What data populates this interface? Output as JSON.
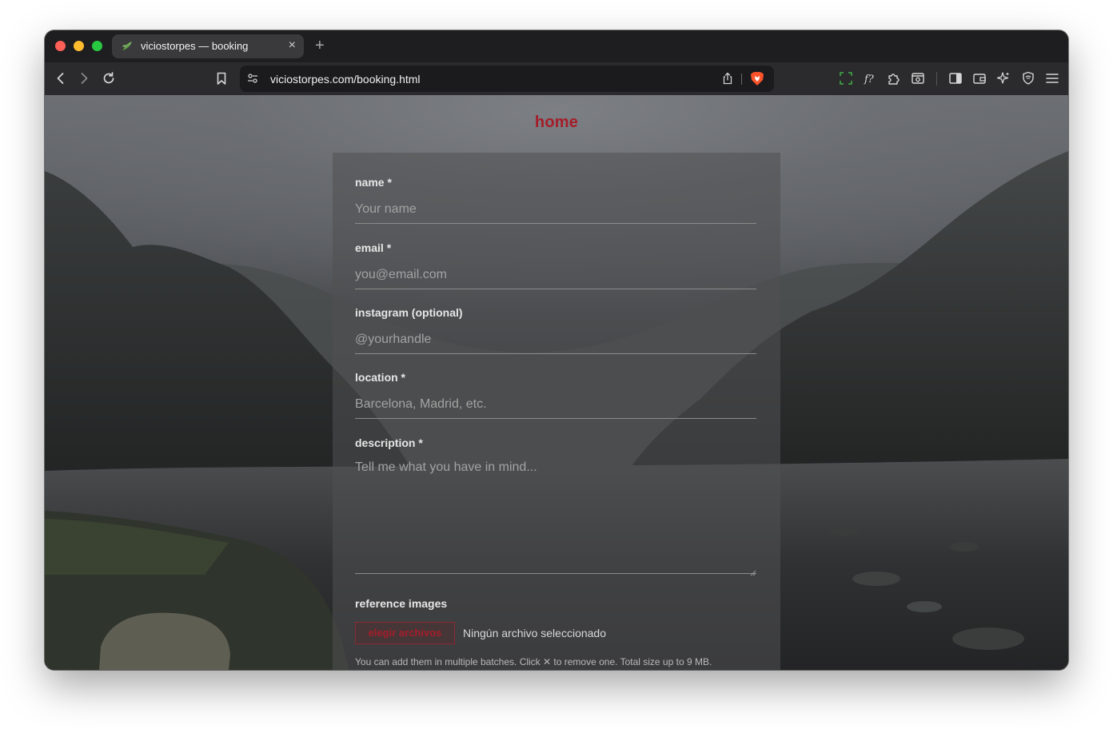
{
  "browser": {
    "tab": {
      "title": "viciostorpes — booking",
      "close_glyph": "×"
    },
    "new_tab_glyph": "+",
    "address_bar": {
      "url": "viciostorpes.com/booking.html"
    },
    "icons": {
      "back": "chevron-left-icon",
      "forward": "chevron-right-icon",
      "reload": "reload-icon",
      "bookmark": "bookmark-icon",
      "site_settings": "tune-icon",
      "share": "share-icon",
      "brave_shields": "brave-lion-icon",
      "screenshot": "screenshot-icon",
      "font": "font-icon",
      "extensions": "puzzle-icon",
      "reader": "reader-icon",
      "sidebar": "sidebar-icon",
      "wallet": "wallet-icon",
      "leo": "sparkle-icon",
      "vpn": "shield-icon",
      "menu": "hamburger-icon"
    },
    "accent_colors": {
      "brave": "#fb542b",
      "traffic_red": "#fe5f57",
      "traffic_yellow": "#febc2e",
      "traffic_green": "#28c840"
    }
  },
  "page": {
    "home_link": "home",
    "accent_color": "#a51d2a",
    "form": {
      "name": {
        "label": "name *",
        "placeholder": "Your name"
      },
      "email": {
        "label": "email *",
        "placeholder": "you@email.com"
      },
      "instagram": {
        "label": "instagram (optional)",
        "placeholder": "@yourhandle"
      },
      "location": {
        "label": "location *",
        "placeholder": "Barcelona, Madrid, etc."
      },
      "description": {
        "label": "description *",
        "placeholder": "Tell me what you have in mind..."
      },
      "reference_images": {
        "label": "reference images",
        "button_label": "elegir archivos",
        "status": "Ningún archivo seleccionado",
        "hint": "You can add them in multiple batches. Click ✕ to remove one. Total size up to 9 MB."
      }
    }
  }
}
